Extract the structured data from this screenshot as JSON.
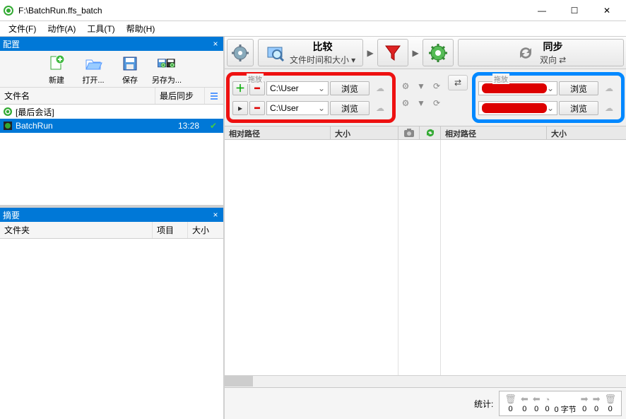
{
  "window": {
    "title": "F:\\BatchRun.ffs_batch"
  },
  "menu": {
    "file": "文件(F)",
    "action": "动作(A)",
    "tools": "工具(T)",
    "help": "帮助(H)"
  },
  "left": {
    "config_title": "配置",
    "toolbar": {
      "new": "新建",
      "open": "打开...",
      "save": "保存",
      "saveas": "另存为..."
    },
    "list_headers": {
      "filename": "文件名",
      "last_sync": "最后同步"
    },
    "rows": [
      {
        "icon": "refresh",
        "name": "[最后会话]",
        "time": "",
        "checked": false,
        "selected": false
      },
      {
        "icon": "batch",
        "name": "BatchRun",
        "time": "13:28",
        "checked": true,
        "selected": true
      }
    ],
    "summary_title": "摘要",
    "summary_headers": {
      "folder": "文件夹",
      "items": "项目",
      "size": "大小"
    }
  },
  "toolbar": {
    "compare": {
      "title": "比较",
      "subtitle": "文件时间和大小"
    },
    "sync": {
      "title": "同步",
      "subtitle": "双向"
    }
  },
  "paths": {
    "drag_label_left": "拖放",
    "drag_label_right": "拖放",
    "left": [
      {
        "value": "C:\\User"
      },
      {
        "value": "C:\\User"
      }
    ],
    "right": [
      {
        "value": "[redacted]"
      },
      {
        "value": "[redacted]"
      }
    ],
    "browse": "浏览"
  },
  "grid": {
    "left_col": "相对路径",
    "left_size": "大小",
    "right_col": "相对路径",
    "right_size": "大小"
  },
  "status": {
    "label": "统计:",
    "values": [
      "0",
      "0",
      "0",
      "0",
      "0 字节",
      "0",
      "0",
      "0"
    ]
  }
}
